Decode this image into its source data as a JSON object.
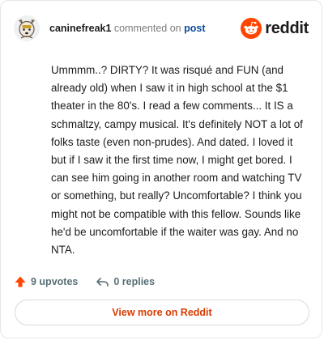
{
  "header": {
    "username": "caninefreak1",
    "action_text": "commented on",
    "post_link": "post",
    "brand": "reddit"
  },
  "comment": {
    "body": "Ummmm..? DIRTY? It was risqué and FUN (and already old) when I saw it in high school at the $1 theater in the 80's. I read a few comments... It IS a schmaltzy, campy musical. It's definitely NOT a lot of folks taste (even non-prudes). And dated. I loved it but if I saw it the first time now, I might get bored. I can see him going in another room and watching TV or something, but really? Uncomfortable? I think you might not be compatible with this fellow. Sounds like he'd be uncomfortable if the waiter was gay. And no NTA."
  },
  "actions": {
    "upvotes": "9 upvotes",
    "replies": "0 replies"
  },
  "footer": {
    "view_more": "View more on Reddit"
  },
  "colors": {
    "brand_orange": "#ff4500",
    "upvote_orange": "#ff4500",
    "link_blue": "#0a4b9b",
    "view_more_text": "#d93a00"
  },
  "icons": {
    "avatar": "dog-avatar-icon",
    "brand": "reddit-logo-icon",
    "upvote": "upvote-arrow-icon",
    "reply": "reply-arrow-icon"
  }
}
